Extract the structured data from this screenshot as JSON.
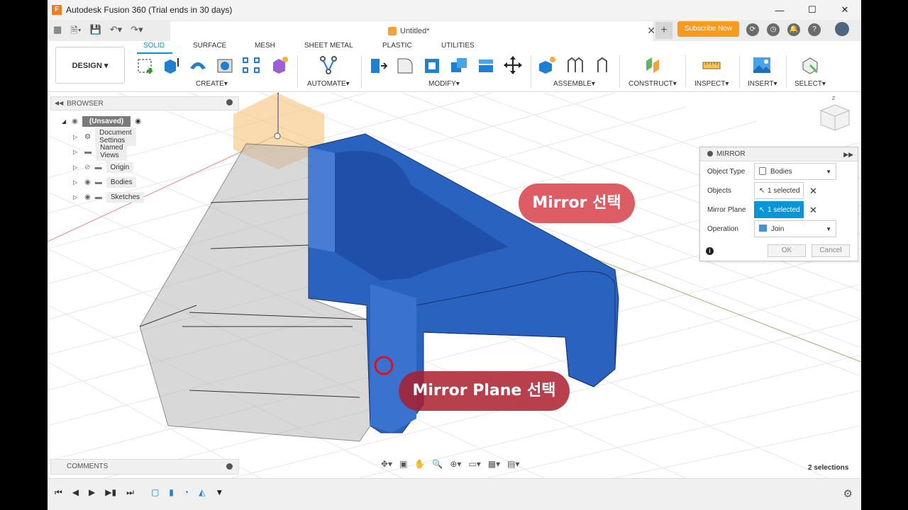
{
  "window": {
    "title": "Autodesk Fusion 360 (Trial ends in 30 days)",
    "controls": [
      "minimize",
      "maximize",
      "close"
    ]
  },
  "tabbar": {
    "document_name": "Untitled*",
    "subscribe_label": "Subscribe Now"
  },
  "ribbon": {
    "workspace": "DESIGN",
    "tabs": [
      "SOLID",
      "SURFACE",
      "MESH",
      "SHEET METAL",
      "PLASTIC",
      "UTILITIES"
    ],
    "active_tab": "SOLID",
    "groups": [
      "CREATE",
      "AUTOMATE",
      "MODIFY",
      "ASSEMBLE",
      "CONSTRUCT",
      "INSPECT",
      "INSERT",
      "SELECT"
    ]
  },
  "browser": {
    "title": "BROWSER",
    "root": "(Unsaved)",
    "items": [
      {
        "label": "Document Settings",
        "icon": "gear-icon"
      },
      {
        "label": "Named Views",
        "icon": "folder-icon"
      },
      {
        "label": "Origin",
        "icon": "folder-icon"
      },
      {
        "label": "Bodies",
        "icon": "folder-icon"
      },
      {
        "label": "Sketches",
        "icon": "folder-icon"
      }
    ]
  },
  "mirror_dialog": {
    "title": "MIRROR",
    "rows": [
      {
        "label": "Object Type",
        "value": "Bodies"
      },
      {
        "label": "Objects",
        "value": "1 selected"
      },
      {
        "label": "Mirror Plane",
        "value": "1 selected"
      },
      {
        "label": "Operation",
        "value": "Join"
      }
    ],
    "ok_label": "OK",
    "cancel_label": "Cancel"
  },
  "callouts": {
    "mirror": "Mirror 선택",
    "mirror_plane": "Mirror Plane 선택"
  },
  "comments": {
    "title": "COMMENTS"
  },
  "status": {
    "selections": "2 selections"
  },
  "colors": {
    "accent": "#0696d7",
    "body_blue": "#2a62c0",
    "callout_red": "#d9474f",
    "subscribe_orange": "#f79a1e"
  }
}
